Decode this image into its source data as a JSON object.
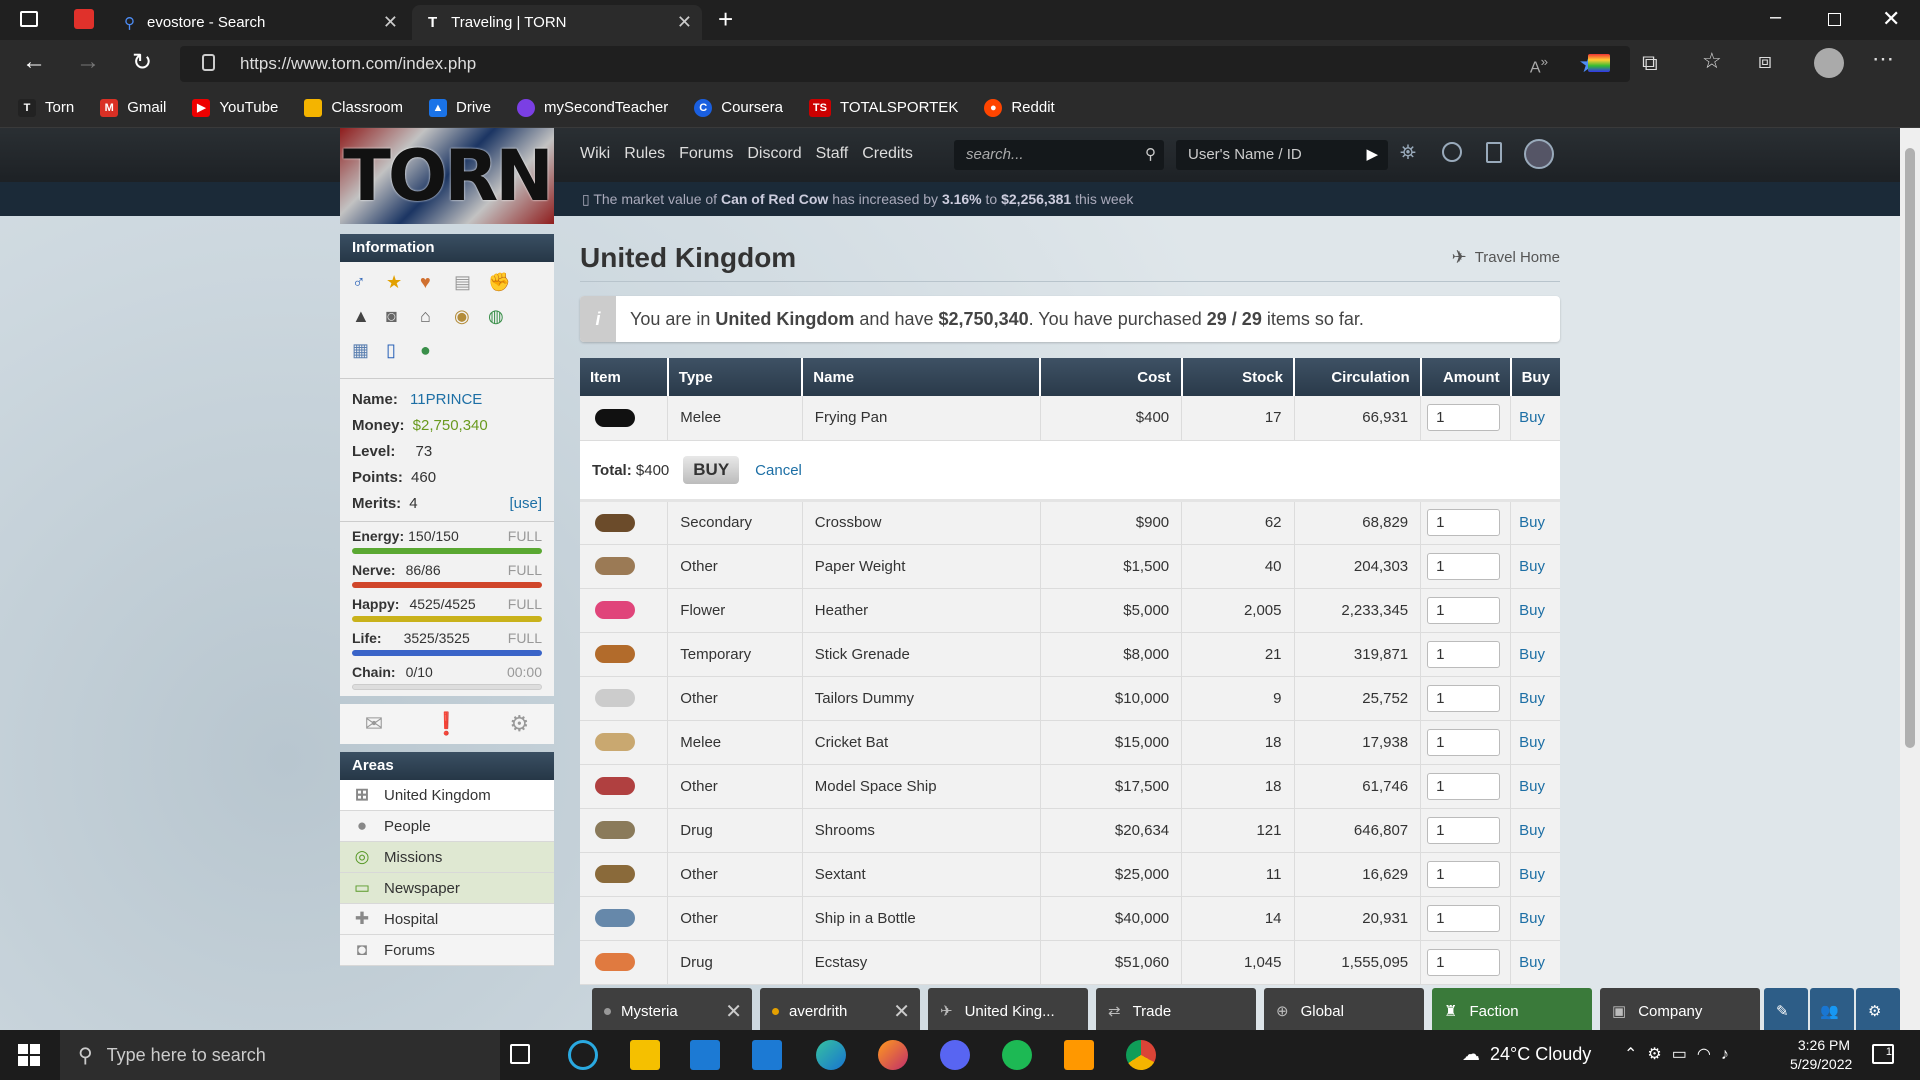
{
  "browser": {
    "tabs": [
      {
        "label": "evostore - Search"
      },
      {
        "label": "Traveling | TORN"
      }
    ],
    "url": "https://www.torn.com/index.php",
    "bookmarks": [
      {
        "label": "Torn",
        "color": "#222"
      },
      {
        "label": "Gmail",
        "color": "#d93025"
      },
      {
        "label": "YouTube",
        "color": "#e00"
      },
      {
        "label": "Classroom",
        "color": "#f4b400"
      },
      {
        "label": "Drive",
        "color": "#1a73e8"
      },
      {
        "label": "mySecondTeacher",
        "color": "#7b3fe4"
      },
      {
        "label": "Coursera",
        "color": "#1a5fe0"
      },
      {
        "label": "TOTALSPORTEK",
        "color": "#c00"
      },
      {
        "label": "Reddit",
        "color": "#ff4500"
      }
    ]
  },
  "torn": {
    "logo": "TORN",
    "nav": [
      "Wiki",
      "Rules",
      "Forums",
      "Discord",
      "Staff",
      "Credits"
    ],
    "search_placeholder": "search...",
    "user_search_placeholder": "User's Name / ID",
    "news": {
      "pre": "The market value of",
      "item": "Can of Red Cow",
      "mid": "has increased by",
      "pct": "3.16%",
      "to": "to",
      "value": "$2,256,381",
      "post": "this week"
    },
    "sidebar": {
      "info_title": "Information",
      "name_label": "Name:",
      "name": "11PRINCE",
      "money_label": "Money:",
      "money": "$2,750,340",
      "level_label": "Level:",
      "level": "73",
      "points_label": "Points:",
      "points": "460",
      "merits_label": "Merits:",
      "merits": "4",
      "merits_use": "[use]",
      "bars": [
        {
          "label": "Energy:",
          "value": "150/150",
          "status": "FULL",
          "fill": 1.0,
          "color": "#5aa832"
        },
        {
          "label": "Nerve:",
          "value": "86/86",
          "status": "FULL",
          "fill": 1.0,
          "color": "#d0462a"
        },
        {
          "label": "Happy:",
          "value": "4525/4525",
          "status": "FULL",
          "fill": 1.0,
          "color": "#c9b21b"
        },
        {
          "label": "Life:",
          "value": "3525/3525",
          "status": "FULL",
          "fill": 1.0,
          "color": "#3a64c8"
        }
      ],
      "chain_label": "Chain:",
      "chain": "0/10",
      "chain_time": "00:00",
      "areas_title": "Areas",
      "areas": [
        "United Kingdom",
        "People",
        "Missions",
        "Newspaper",
        "Hospital",
        "Forums"
      ]
    },
    "main": {
      "title": "United Kingdom",
      "travel_home": "Travel Home",
      "info": {
        "p1": "You are in",
        "country": "United Kingdom",
        "p2": "and have",
        "money": "$2,750,340",
        "p3": ". You have purchased",
        "count": "29 / 29",
        "p4": "items so far."
      },
      "columns": [
        "Item",
        "Type",
        "Name",
        "Cost",
        "Stock",
        "Circulation",
        "Amount",
        "Buy"
      ],
      "total_label": "Total:",
      "total": "$400",
      "buy_btn": "BUY",
      "cancel": "Cancel",
      "items": [
        {
          "type": "Melee",
          "name": "Frying Pan",
          "cost": "$400",
          "stock": "17",
          "circ": "66,931",
          "amount": "1",
          "buy": "Buy"
        },
        {
          "type": "Secondary",
          "name": "Crossbow",
          "cost": "$900",
          "stock": "62",
          "circ": "68,829",
          "amount": "1",
          "buy": "Buy"
        },
        {
          "type": "Other",
          "name": "Paper Weight",
          "cost": "$1,500",
          "stock": "40",
          "circ": "204,303",
          "amount": "1",
          "buy": "Buy"
        },
        {
          "type": "Flower",
          "name": "Heather",
          "cost": "$5,000",
          "stock": "2,005",
          "circ": "2,233,345",
          "amount": "1",
          "buy": "Buy"
        },
        {
          "type": "Temporary",
          "name": "Stick Grenade",
          "cost": "$8,000",
          "stock": "21",
          "circ": "319,871",
          "amount": "1",
          "buy": "Buy"
        },
        {
          "type": "Other",
          "name": "Tailors Dummy",
          "cost": "$10,000",
          "stock": "9",
          "circ": "25,752",
          "amount": "1",
          "buy": "Buy"
        },
        {
          "type": "Melee",
          "name": "Cricket Bat",
          "cost": "$15,000",
          "stock": "18",
          "circ": "17,938",
          "amount": "1",
          "buy": "Buy"
        },
        {
          "type": "Other",
          "name": "Model Space Ship",
          "cost": "$17,500",
          "stock": "18",
          "circ": "61,746",
          "amount": "1",
          "buy": "Buy"
        },
        {
          "type": "Drug",
          "name": "Shrooms",
          "cost": "$20,634",
          "stock": "121",
          "circ": "646,807",
          "amount": "1",
          "buy": "Buy"
        },
        {
          "type": "Other",
          "name": "Sextant",
          "cost": "$25,000",
          "stock": "11",
          "circ": "16,629",
          "amount": "1",
          "buy": "Buy"
        },
        {
          "type": "Other",
          "name": "Ship in a Bottle",
          "cost": "$40,000",
          "stock": "14",
          "circ": "20,931",
          "amount": "1",
          "buy": "Buy"
        },
        {
          "type": "Drug",
          "name": "Ecstasy",
          "cost": "$51,060",
          "stock": "1,045",
          "circ": "1,555,095",
          "amount": "1",
          "buy": "Buy"
        }
      ]
    },
    "chat": [
      "Mysteria",
      "averdrith",
      "United King...",
      "Trade",
      "Global",
      "Faction",
      "Company"
    ]
  },
  "taskbar": {
    "search_placeholder": "Type here to search",
    "weather": "24°C  Cloudy",
    "time": "3:26 PM",
    "date": "5/29/2022",
    "notif": "1"
  }
}
